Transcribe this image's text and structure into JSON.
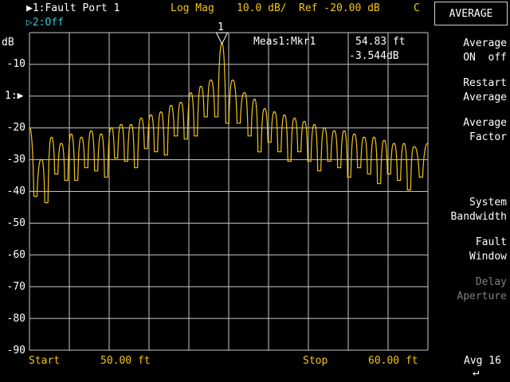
{
  "header": {
    "channel1_label": "▶1:Fault Port 1",
    "format": "Log Mag",
    "scale": "10.0 dB/",
    "ref": "Ref -20.00 dB",
    "cal_indicator": "C",
    "channel2_label": "▷2:Off"
  },
  "plot": {
    "y_unit": "dB",
    "ref_marker": "1:▶",
    "y_ticks": [
      "-10",
      "-20",
      "-30",
      "-40",
      "-50",
      "-60",
      "-70",
      "-80",
      "-90"
    ],
    "marker_number": "1",
    "marker_readout": {
      "name": "Meas1:Mkr1",
      "position": "54.83 ft",
      "value": "-3.544dB"
    },
    "colors": {
      "trace": "#f2c417",
      "grid": "#c8c8c8",
      "background": "#000000"
    }
  },
  "footer": {
    "start_label": "Start",
    "start_value": "50.00 ft",
    "stop_label": "Stop",
    "stop_value": "60.00 ft"
  },
  "softkeys": {
    "title": "AVERAGE",
    "average_line1": "Average",
    "average_line2": "ON  off",
    "restart_line1": "Restart",
    "restart_line2": "Average",
    "factor_line1": "Average",
    "factor_line2": "Factor",
    "bandwidth_line1": "System",
    "bandwidth_line2": "Bandwidth",
    "fault_line1": "Fault",
    "fault_line2": "Window",
    "delay_line1": "Delay",
    "delay_line2": "Aperture",
    "avg_count": "Avg 16",
    "return_icon": "↵"
  },
  "chart_data": {
    "type": "line",
    "xlabel": "",
    "ylabel": "dB",
    "xlim": [
      50.0,
      60.0
    ],
    "ylim": [
      -100,
      0
    ],
    "grid": true,
    "marker": {
      "x": 54.83,
      "y": -3.544
    },
    "series": [
      {
        "x": [
          50.0,
          50.3,
          50.55,
          50.8,
          51.05,
          51.3,
          51.55,
          51.8,
          52.05,
          52.3,
          52.55,
          52.8,
          53.05,
          53.3,
          53.55,
          53.8,
          54.05,
          54.3,
          54.55,
          54.83,
          55.1,
          55.4,
          55.65,
          55.9,
          56.15,
          56.4,
          56.65,
          56.9,
          57.15,
          57.4,
          57.65,
          57.9,
          58.15,
          58.4,
          58.65,
          58.9,
          59.15,
          59.4,
          59.65,
          60.0
        ],
        "y": [
          -30,
          -40,
          -33,
          -35,
          -32,
          -33,
          -31,
          -32,
          -30,
          -29,
          -29,
          -27,
          -26,
          -25,
          -23,
          -22,
          -19,
          -17,
          -15,
          -3.544,
          -15,
          -19,
          -21,
          -24,
          -25,
          -26,
          -27,
          -28,
          -29,
          -30,
          -31,
          -31,
          -32,
          -33,
          -33,
          -34,
          -35,
          -35,
          -36,
          -35
        ]
      }
    ]
  }
}
